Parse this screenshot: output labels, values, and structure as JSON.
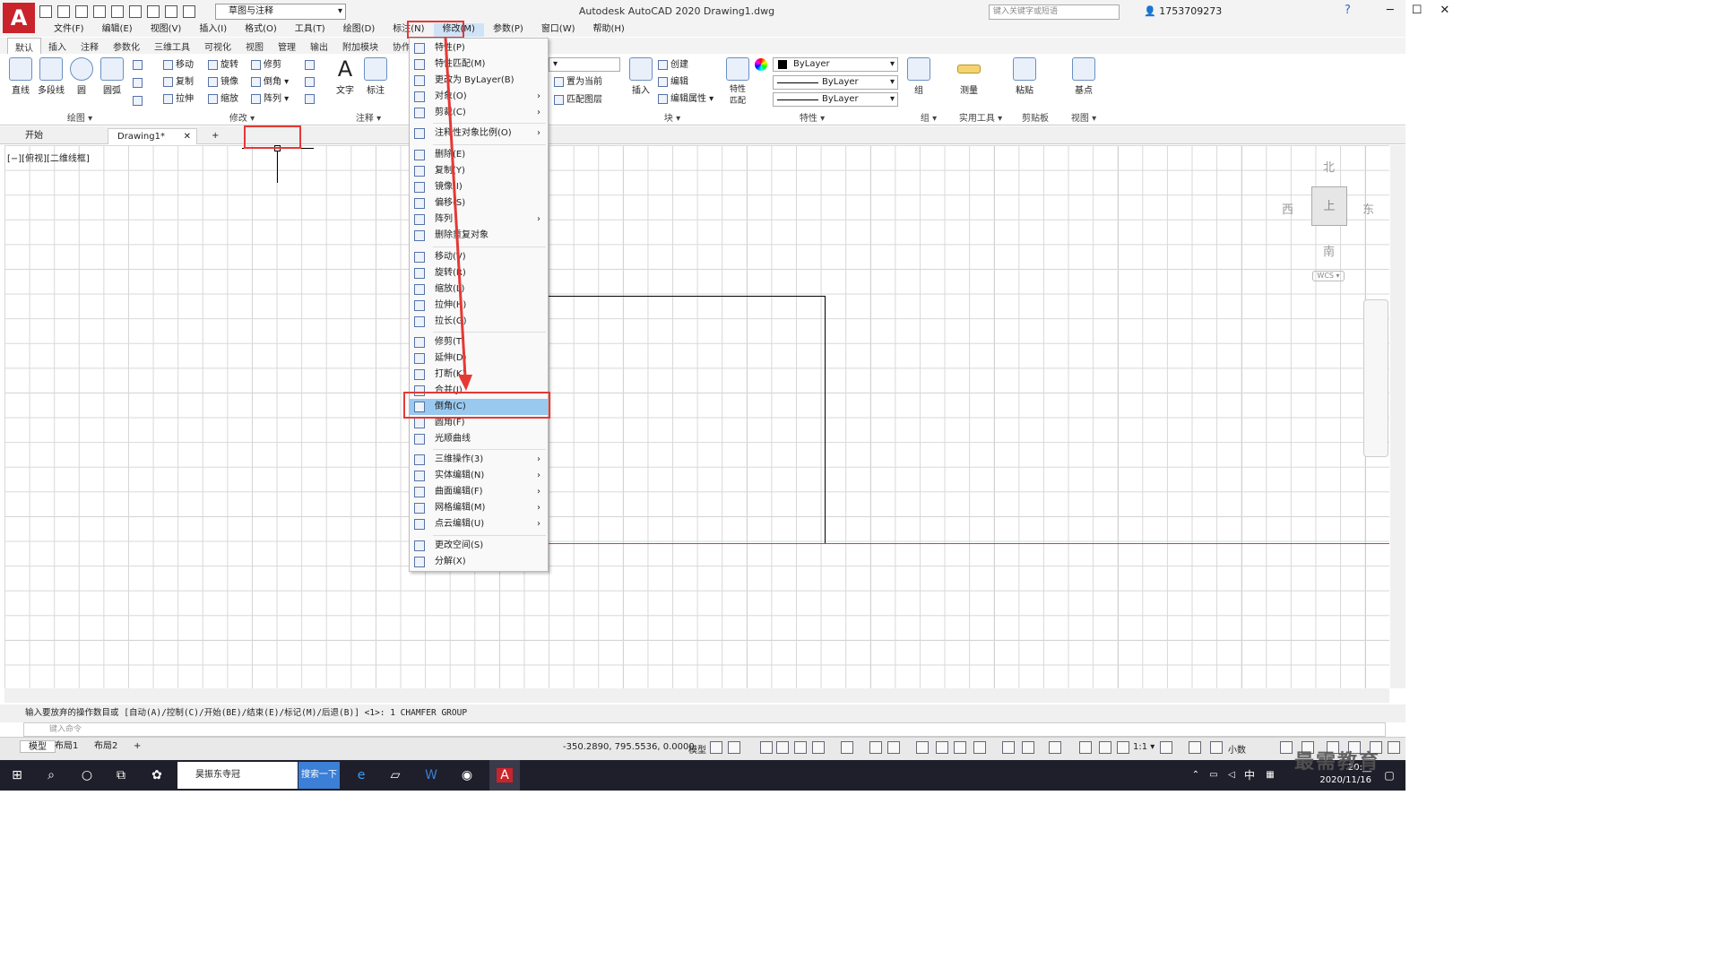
{
  "app": {
    "logo": "A",
    "title": "Autodesk AutoCAD 2020    Drawing1.dwg",
    "workspace": "草图与注释",
    "search_placeholder": "键入关键字或短语",
    "user": "1753709273",
    "help": "?",
    "win_min": "─",
    "win_max": "☐",
    "win_close": "✕"
  },
  "menubar": [
    "文件(F)",
    "编辑(E)",
    "视图(V)",
    "插入(I)",
    "格式(O)",
    "工具(T)",
    "绘图(D)",
    "标注(N)",
    "修改(M)",
    "参数(P)",
    "窗口(W)",
    "帮助(H)"
  ],
  "ribbon_tabs": [
    "默认",
    "插入",
    "注释",
    "参数化",
    "三维工具",
    "可视化",
    "视图",
    "管理",
    "输出",
    "附加模块",
    "协作"
  ],
  "ribbon": {
    "draw": {
      "line": "直线",
      "polyline": "多段线",
      "circle": "圆",
      "arc": "圆弧",
      "label": "绘图 ▾"
    },
    "modify": {
      "move": "移动",
      "rotate": "旋转",
      "trim": "修剪",
      "copy": "复制",
      "mirror": "镜像",
      "chamfer": "倒角",
      "stretch": "拉伸",
      "scale": "缩放",
      "array": "阵列",
      "label": "修改 ▾"
    },
    "annotation": {
      "text": "文字",
      "dim": "标注",
      "label": "注释 ▾"
    },
    "layers": {
      "set_current": "置为当前",
      "match_layer": "匹配图层"
    },
    "block": {
      "insert": "插入",
      "create": "创建",
      "edit": "编辑",
      "edit_attr": "编辑属性",
      "label": "块 ▾"
    },
    "properties": {
      "match": "特性\n匹配",
      "color": "ByLayer",
      "linetype": "ByLayer",
      "lineweight": "ByLayer",
      "label": "特性 ▾"
    },
    "group": {
      "group": "组",
      "label": "组 ▾"
    },
    "utilities": {
      "measure": "测量",
      "label": "实用工具 ▾"
    },
    "clipboard": {
      "paste": "粘贴",
      "label": "剪贴板"
    },
    "view": {
      "base": "基点",
      "label": "视图 ▾"
    }
  },
  "doctabs": {
    "start": "开始",
    "drawing": "Drawing1*",
    "close": "✕",
    "add": "+"
  },
  "viewport_label": "[−][俯视][二维线框]",
  "viewcube": {
    "n": "北",
    "s": "南",
    "e": "东",
    "w": "西",
    "top": "上",
    "wcs": "WCS ▾"
  },
  "modify_menu": [
    {
      "label": "特性(P)"
    },
    {
      "label": "特性匹配(M)"
    },
    {
      "label": "更改为 ByLayer(B)"
    },
    {
      "label": "对象(O)",
      "sub": true
    },
    {
      "label": "剪裁(C)",
      "sub": true
    },
    {
      "label": "注释性对象比例(O)",
      "sub": true
    },
    {
      "label": "删除(E)"
    },
    {
      "label": "复制(Y)"
    },
    {
      "label": "镜像(I)"
    },
    {
      "label": "偏移(S)"
    },
    {
      "label": "阵列",
      "sub": true
    },
    {
      "label": "删除重复对象"
    },
    {
      "label": "移动(V)"
    },
    {
      "label": "旋转(R)"
    },
    {
      "label": "缩放(L)"
    },
    {
      "label": "拉伸(H)"
    },
    {
      "label": "拉长(G)"
    },
    {
      "label": "修剪(T)"
    },
    {
      "label": "延伸(D)"
    },
    {
      "label": "打断(K)"
    },
    {
      "label": "合并(J)"
    },
    {
      "label": "倒角(C)",
      "highlight": true
    },
    {
      "label": "圆角(F)"
    },
    {
      "label": "光顺曲线"
    },
    {
      "label": "三维操作(3)",
      "sub": true
    },
    {
      "label": "实体编辑(N)",
      "sub": true
    },
    {
      "label": "曲面编辑(F)",
      "sub": true
    },
    {
      "label": "网格编辑(M)",
      "sub": true
    },
    {
      "label": "点云编辑(U)",
      "sub": true
    },
    {
      "label": "更改空间(S)"
    },
    {
      "label": "分解(X)"
    }
  ],
  "command": {
    "history": "输入要放弃的操作数目或 [自动(A)/控制(C)/开始(BE)/结束(E)/标记(M)/后退(B)] <1>: 1 CHAMFER GROUP",
    "placeholder": "键入命令"
  },
  "layout_tabs": [
    "模型",
    "布局1",
    "布局2",
    "+"
  ],
  "status": {
    "coords": "-350.2890, 795.5536, 0.0000",
    "model": "模型",
    "scale": "1:1 ▾",
    "units": "小数"
  },
  "taskbar": {
    "search": "昊振东寺冠",
    "search_btn": "搜索一下",
    "time": "20:__",
    "date": "2020/11/16",
    "ime": "中"
  },
  "watermark": "最需教育",
  "colors": {
    "accent_red": "#e53935",
    "menu_highlight": "#99c9ef",
    "logo": "#c9242b"
  }
}
